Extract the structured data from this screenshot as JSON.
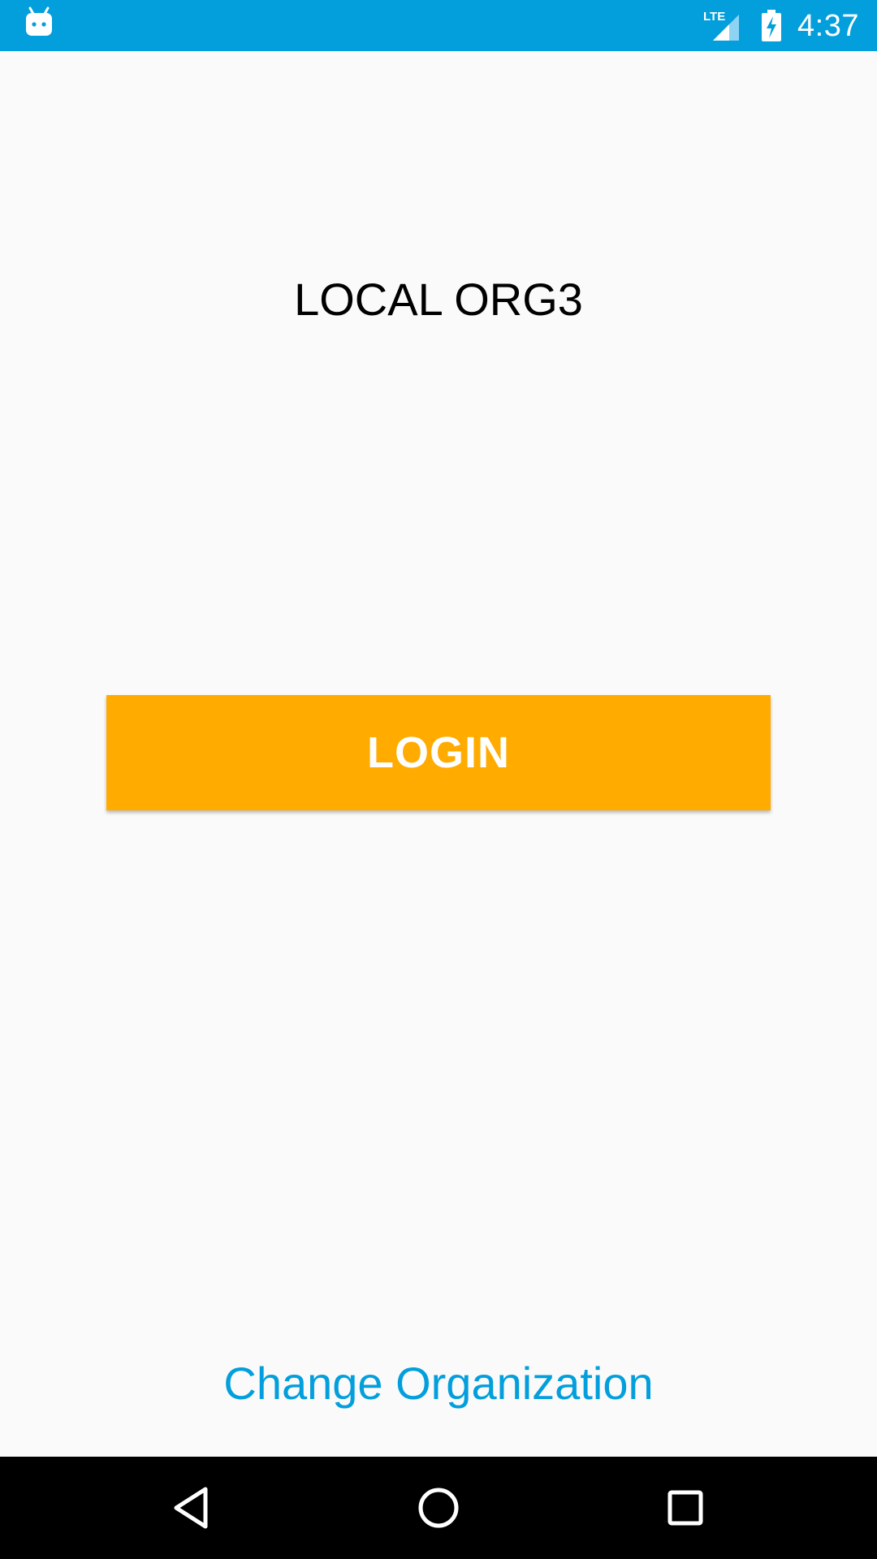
{
  "status_bar": {
    "background": "#039fdc",
    "time": "4:37",
    "network_label": "LTE",
    "icons": [
      "android-icon",
      "lte-signal-icon",
      "battery-charging-icon"
    ]
  },
  "main": {
    "organization_name": "LOCAL ORG3",
    "login_label": "LOGIN",
    "login_color": "#ffab00",
    "change_org_label": "Change Organization",
    "link_color": "#039fdc"
  },
  "nav_bar": {
    "icons": [
      "back-icon",
      "home-icon",
      "recents-icon"
    ]
  }
}
